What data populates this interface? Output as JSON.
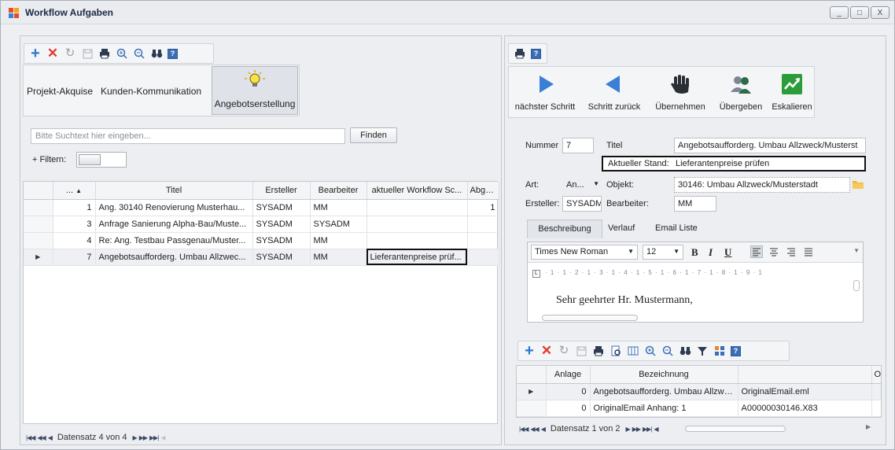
{
  "window": {
    "title": "Workflow Aufgaben",
    "controls": [
      "_",
      "□",
      "X"
    ]
  },
  "left": {
    "tabs": [
      "Projekt-Akquise",
      "Kunden-Kommunikation",
      "Angebotserstellung"
    ],
    "search": {
      "placeholder": "Bitte Suchtext hier eingeben...",
      "button": "Finden",
      "filter_label": "+ Filtern:"
    },
    "grid": {
      "columns": [
        "...",
        "Titel",
        "Ersteller",
        "Bearbeiter",
        "aktueller Workflow Sc...",
        "Abgeschlos..."
      ],
      "rows": [
        {
          "num": "1",
          "titel": "Ang. 30140  Renovierung Musterhau...",
          "ersteller": "SYSADM",
          "bearbeiter": "MM",
          "workflow": "",
          "abgeschlossen": "1"
        },
        {
          "num": "3",
          "titel": "Anfrage Sanierung Alpha-Bau/Muste...",
          "ersteller": "SYSADM",
          "bearbeiter": "SYSADM",
          "workflow": "",
          "abgeschlossen": ""
        },
        {
          "num": "4",
          "titel": "Re: Ang. Testbau Passgenau/Muster...",
          "ersteller": "SYSADM",
          "bearbeiter": "MM",
          "workflow": "",
          "abgeschlossen": ""
        },
        {
          "num": "7",
          "titel": "Angebotsaufforderg. Umbau Allzwec...",
          "ersteller": "SYSADM",
          "bearbeiter": "MM",
          "workflow": "Lieferantenpreise prüf...",
          "abgeschlossen": ""
        }
      ]
    },
    "pager": "Datensatz 4 von 4"
  },
  "right": {
    "actions": [
      {
        "label": "nächster Schritt",
        "icon": "play-right-icon"
      },
      {
        "label": "Schritt zurück",
        "icon": "play-left-icon"
      },
      {
        "label": "Übernehmen",
        "icon": "hand-icon"
      },
      {
        "label": "Übergeben",
        "icon": "users-icon"
      },
      {
        "label": "Eskalieren",
        "icon": "trend-up-icon"
      }
    ],
    "form": {
      "nummer_label": "Nummer",
      "nummer": "7",
      "titel_label": "Titel",
      "titel": "Angebotsaufforderg. Umbau Allzweck/Musterst",
      "stand_label": "Aktueller Stand:",
      "stand": "Lieferantenpreise prüfen",
      "art_label": "Art:",
      "art": "An...",
      "objekt_label": "Objekt:",
      "objekt": "30146: Umbau Allzweck/Musterstadt",
      "ersteller_label": "Ersteller:",
      "ersteller": "SYSADM",
      "bearbeiter_label": "Bearbeiter:",
      "bearbeiter": "MM"
    },
    "detail_tabs": [
      "Beschreibung",
      "Verlauf",
      "Email Liste"
    ],
    "editor": {
      "font": "Times New Roman",
      "size": "12",
      "ruler": "· 1 · 1 · 2 · 1 · 3 · 1 · 4 · 1 · 5 · 1 · 6 · 1 · 7 · 1 · 8 · 1 · 9 · 1",
      "content": "Sehr geehrter Hr. Mustermann,"
    },
    "attachments": {
      "columns": [
        "Anlage",
        "Bezeichnung",
        "Or"
      ],
      "rows": [
        {
          "anlage": "0",
          "bezeichnung": "Angebotsaufforderg. Umbau Allzweck...",
          "or": "OriginalEmail.eml"
        },
        {
          "anlage": "0",
          "bezeichnung": "OriginalEmail Anhang: 1",
          "or": "A00000030146.X83"
        }
      ],
      "pager": "Datensatz 1 von 2"
    }
  },
  "colors": {
    "accent_blue": "#3a7fd5",
    "delete_red": "#e03a2e",
    "eskalieren_green": "#2a9d3a",
    "highlight_border": "#111111"
  }
}
